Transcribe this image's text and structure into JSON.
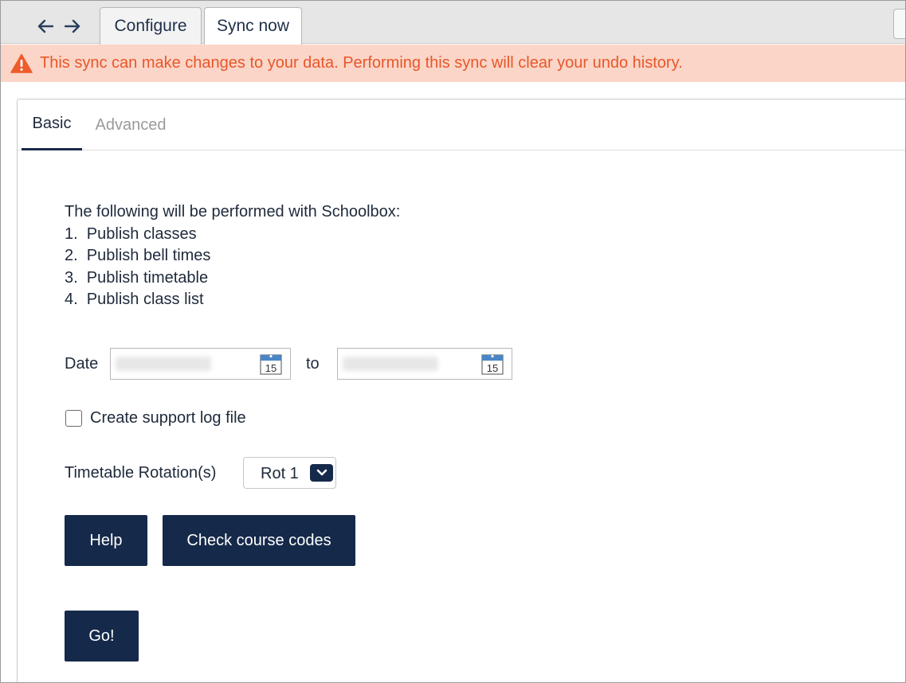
{
  "nav": {
    "back_icon": "arrow-left-icon",
    "forward_icon": "arrow-right-icon"
  },
  "tabs": [
    {
      "label": "Configure",
      "active": false
    },
    {
      "label": "Sync now",
      "active": true
    }
  ],
  "warning": {
    "icon": "warning-triangle-icon",
    "text": "This sync can make changes to your data. Performing this sync will clear your undo history.",
    "color": "#e8572a",
    "background": "#fbd5c7"
  },
  "subtabs": [
    {
      "label": "Basic",
      "active": true
    },
    {
      "label": "Advanced",
      "active": false
    }
  ],
  "intro": "The following will be performed with Schoolbox:",
  "steps": [
    "1.  Publish classes",
    "2.  Publish bell times",
    "3.  Publish timetable",
    "4.  Publish class list"
  ],
  "date": {
    "label": "Date",
    "to_label": "to",
    "calendar_icon": "calendar-icon",
    "calendar_day": "15"
  },
  "support_log": {
    "label": "Create support log file",
    "checked": false
  },
  "rotation": {
    "label": "Timetable Rotation(s)",
    "value": "Rot 1"
  },
  "buttons": {
    "help": "Help",
    "check_codes": "Check course codes",
    "go": "Go!"
  },
  "colors": {
    "primary": "#15294a"
  }
}
